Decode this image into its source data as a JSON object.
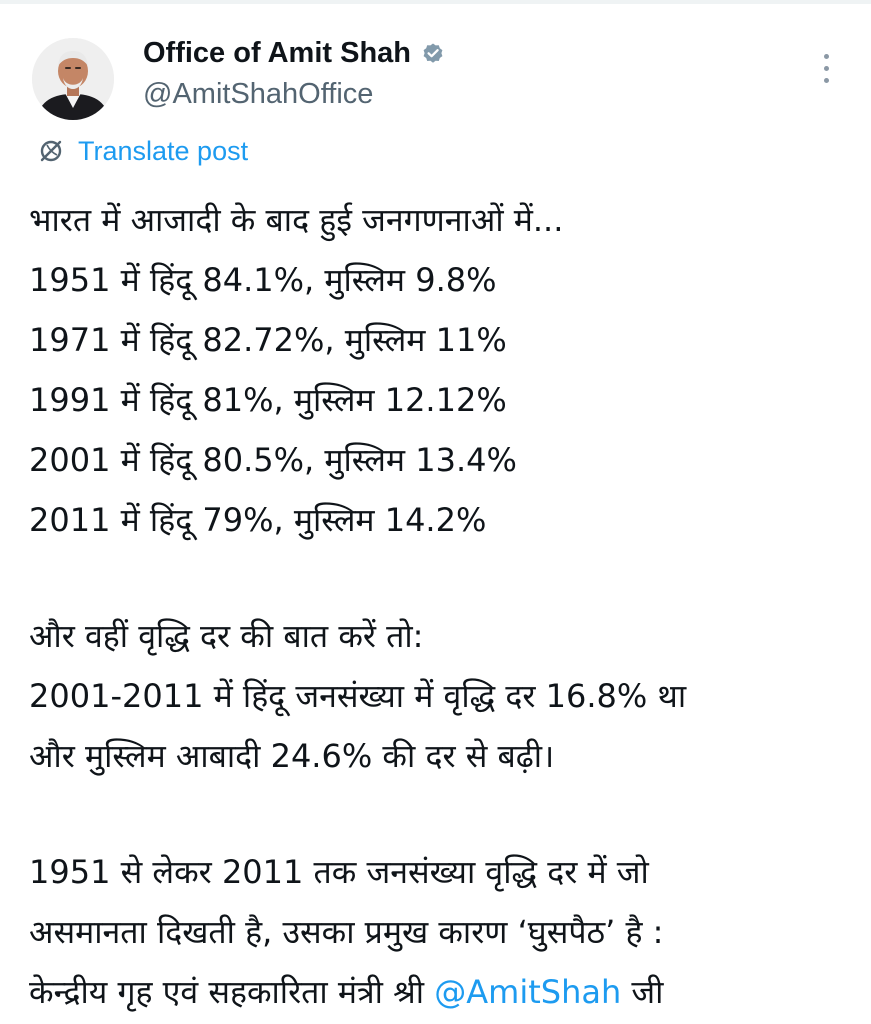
{
  "author": {
    "display_name": "Office of Amit Shah",
    "handle": "@AmitShahOffice",
    "avatar": "profile-photo",
    "verified_icon": "verified-badge-icon"
  },
  "more_icon": "more-vertical-icon",
  "translate": {
    "icon": "translate-globe-icon",
    "label": "Translate post"
  },
  "post": {
    "paragraph_1": [
      "भारत में आजादी के बाद हुई जनगणनाओं में...",
      "1951 में हिंदू 84.1%, मुस्लिम 9.8%",
      "1971 में हिंदू 82.72%, मुस्लिम 11%",
      "1991 में हिंदू 81%, मुस्लिम 12.12%",
      "2001 में हिंदू 80.5%, मुस्लिम 13.4%",
      "2011 में हिंदू 79%, मुस्लिम 14.2%"
    ],
    "paragraph_2": [
      "और वहीं वृद्धि दर की बात करें तो:",
      "2001-2011 में हिंदू जनसंख्या में वृद्धि दर 16.8% था",
      "और मुस्लिम आबादी 24.6% की दर से बढ़ी।"
    ],
    "paragraph_3": [
      "1951 से लेकर 2011 तक जनसंख्या वृद्धि दर में जो",
      "असमानता दिखती है, उसका प्रमुख कारण ‘घुसपैठ’ है :"
    ],
    "last_line_prefix": "केन्द्रीय गृह एवं सहकारिता मंत्री श्री ",
    "mention": "@AmitShah",
    "last_line_suffix": " जी"
  },
  "colors": {
    "text": "#0f1419",
    "secondary": "#536471",
    "link": "#1d9bf0",
    "verified_badge": "#829aab"
  }
}
